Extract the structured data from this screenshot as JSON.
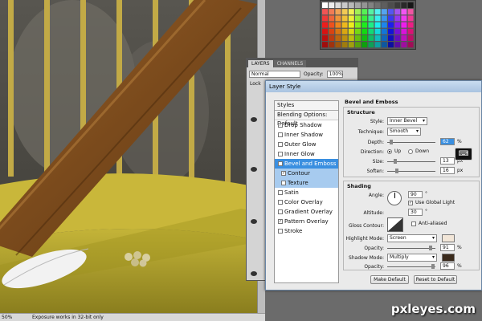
{
  "statusbar": {
    "zoom": "50%",
    "info": "Exposure works in 32-bit only"
  },
  "layers_panel": {
    "tabs": [
      "LAYERS",
      "CHANNELS"
    ],
    "blend_mode": "Normal",
    "opacity_label": "Opacity:",
    "opacity_value": "100%",
    "lock_label": "Lock"
  },
  "dialog": {
    "title": "Layer Style",
    "styles_header": "Styles",
    "blending_options": "Blending Options: Default",
    "effects": [
      {
        "label": "Drop Shadow",
        "checked": true,
        "selected": false,
        "sub": false
      },
      {
        "label": "Inner Shadow",
        "checked": false,
        "selected": false,
        "sub": false
      },
      {
        "label": "Outer Glow",
        "checked": false,
        "selected": false,
        "sub": false
      },
      {
        "label": "Inner Glow",
        "checked": false,
        "selected": false,
        "sub": false
      },
      {
        "label": "Bevel and Emboss",
        "checked": true,
        "selected": true,
        "sub": false
      },
      {
        "label": "Contour",
        "checked": true,
        "selected": false,
        "sub": true
      },
      {
        "label": "Texture",
        "checked": false,
        "selected": false,
        "sub": true
      },
      {
        "label": "Satin",
        "checked": false,
        "selected": false,
        "sub": false
      },
      {
        "label": "Color Overlay",
        "checked": false,
        "selected": false,
        "sub": false
      },
      {
        "label": "Gradient Overlay",
        "checked": false,
        "selected": false,
        "sub": false
      },
      {
        "label": "Pattern Overlay",
        "checked": true,
        "selected": false,
        "sub": false
      },
      {
        "label": "Stroke",
        "checked": false,
        "selected": false,
        "sub": false
      }
    ],
    "section_title": "Bevel and Emboss",
    "structure": {
      "title": "Structure",
      "style_label": "Style:",
      "style_value": "Inner Bevel",
      "technique_label": "Technique:",
      "technique_value": "Smooth",
      "depth_label": "Depth:",
      "depth_value": "62",
      "depth_unit": "%",
      "direction_label": "Direction:",
      "dir_up": "Up",
      "dir_down": "Down",
      "size_label": "Size:",
      "size_value": "13",
      "size_unit": "px",
      "soften_label": "Soften:",
      "soften_value": "16",
      "soften_unit": "px"
    },
    "shading": {
      "title": "Shading",
      "angle_label": "Angle:",
      "angle_value": "90",
      "angle_unit": "°",
      "use_global": "Use Global Light",
      "altitude_label": "Altitude:",
      "altitude_value": "30",
      "altitude_unit": "°",
      "gloss_label": "Gloss Contour:",
      "anti_aliased": "Anti-aliased",
      "highlight_label": "Highlight Mode:",
      "highlight_value": "Screen",
      "highlight_opacity_label": "Opacity:",
      "highlight_opacity": "91",
      "highlight_opacity_unit": "%",
      "highlight_color": "#f2e6d8",
      "shadow_label": "Shadow Mode:",
      "shadow_value": "Multiply",
      "shadow_opacity_label": "Opacity:",
      "shadow_opacity": "96",
      "shadow_opacity_unit": "%",
      "shadow_color": "#3a2a1c"
    },
    "make_default": "Make Default",
    "reset_default": "Reset to Default"
  },
  "watermark": "pxleyes.com",
  "colors": {
    "canvas_dark": "#3a3a36",
    "cage_bars": "#b8a040",
    "branch": "#7a4a1c",
    "tray": "#a89a2a",
    "dialog_bg": "#eaeaea",
    "selection": "#3a8fe0"
  }
}
